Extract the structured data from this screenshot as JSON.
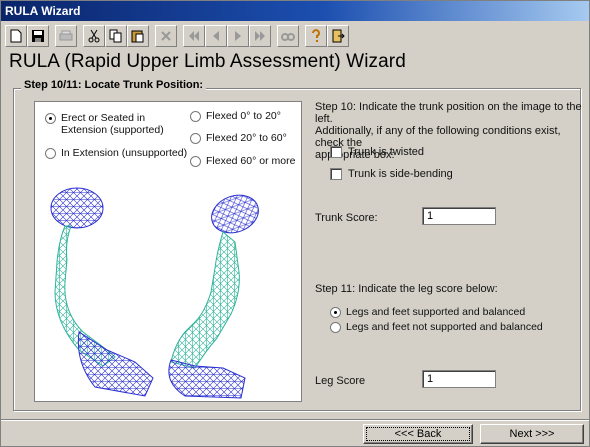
{
  "window": {
    "title": "RULA Wizard"
  },
  "toolbar": {
    "icons": [
      "new-icon",
      "save-icon",
      "print-icon",
      "cut-icon",
      "copy-icon",
      "paste-icon",
      "delete-icon",
      "first-icon",
      "prev-icon",
      "next-icon",
      "last-icon",
      "find-icon",
      "help-icon",
      "exit-icon"
    ]
  },
  "page": {
    "heading": "RULA (Rapid Upper Limb Assessment) Wizard",
    "group_title": "Step 10/11:  Locate Trunk Position:"
  },
  "trunk_options": [
    {
      "label_line1": "Erect or Seated in",
      "label_line2": "Extension (supported)",
      "selected": true
    },
    {
      "label_line1": "In Extension (unsupported)",
      "label_line2": "",
      "selected": false
    },
    {
      "label_line1": "Flexed 0° to 20°",
      "label_line2": "",
      "selected": false
    },
    {
      "label_line1": "Flexed 20° to 60°",
      "label_line2": "",
      "selected": false
    },
    {
      "label_line1": "Flexed 60° or more",
      "label_line2": "",
      "selected": false
    }
  ],
  "step10": {
    "line1": "Step 10:  Indicate the trunk position on the image to the left.",
    "line2": "Additionally, if any of the following conditions exist, check the",
    "line3": "appropriate box:",
    "twisted_label": "Trunk is twisted",
    "sidebending_label": "Trunk is side-bending",
    "trunk_score_label": "Trunk Score:",
    "trunk_score_value": "1"
  },
  "step11": {
    "line1": "Step 11:  Indicate the leg score below:",
    "leg_option_1": "Legs and feet supported and balanced",
    "leg_option_2": "Legs and feet not supported and balanced",
    "leg_score_label": "Leg Score",
    "leg_score_value": "1"
  },
  "nav": {
    "back_label": "<<< Back",
    "next_label": "Next >>>"
  },
  "colors": {
    "head": "#2a2fd0",
    "torso": "#2fb39a",
    "pelvis": "#2a2fd0"
  }
}
